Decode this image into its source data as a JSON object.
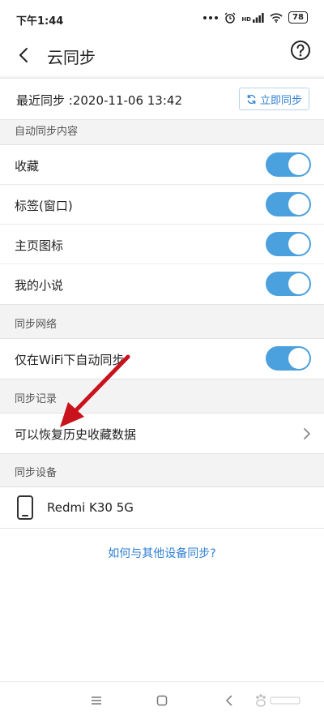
{
  "status_bar": {
    "time": "下午1:44",
    "hd_label": "HD",
    "battery": "78"
  },
  "app_bar": {
    "title": "云同步"
  },
  "sync": {
    "last_sync": "最近同步 :2020-11-06 13:42",
    "button_label": "立即同步"
  },
  "sections": {
    "auto_sync": {
      "header": "自动同步内容",
      "items": [
        {
          "label": "收藏",
          "enabled": true
        },
        {
          "label": "标签(窗口)",
          "enabled": true
        },
        {
          "label": "主页图标",
          "enabled": true
        },
        {
          "label": "我的小说",
          "enabled": true
        }
      ]
    },
    "network": {
      "header": "同步网络",
      "items": [
        {
          "label": "仅在WiFi下自动同步",
          "enabled": true
        }
      ]
    },
    "records": {
      "header": "同步记录",
      "items": [
        {
          "label": "可以恢复历史收藏数据"
        }
      ]
    },
    "devices": {
      "header": "同步设备",
      "items": [
        {
          "label": "Redmi K30 5G"
        }
      ]
    }
  },
  "help_link": "如何与其他设备同步?",
  "colors": {
    "accent": "#4ba1dd",
    "link": "#2f7fd1",
    "annotation": "#c8121c"
  }
}
